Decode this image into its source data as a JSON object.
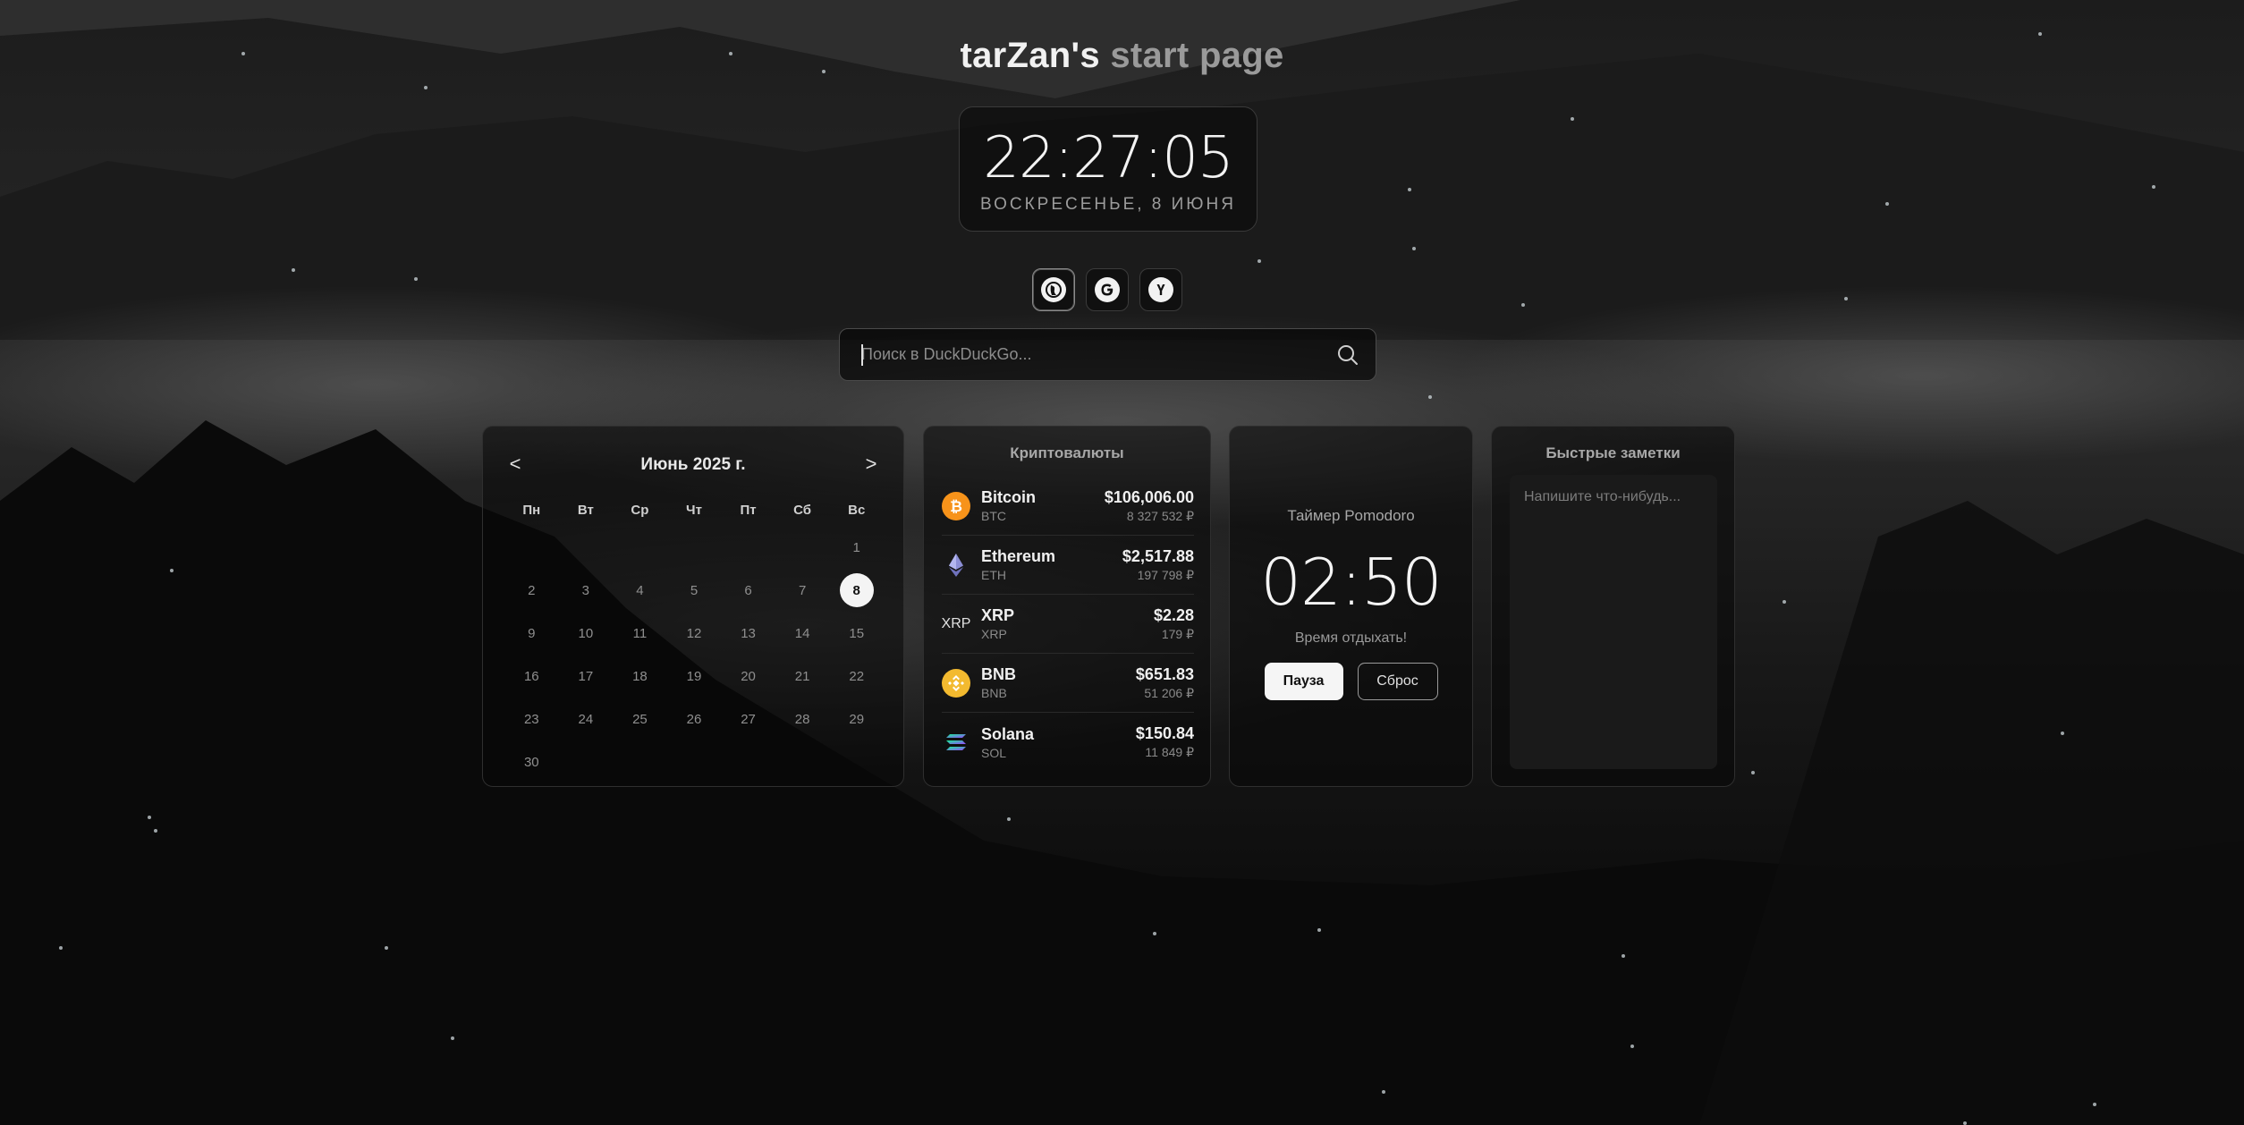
{
  "page_title": {
    "part1": "tarZan's",
    "part2": "start page"
  },
  "clock": {
    "time": "22:27:05",
    "date": "ВОСКРЕСЕНЬЕ, 8 ИЮНЯ"
  },
  "engines": [
    {
      "name": "DuckDuckGo",
      "glyph": "duckduckgo-icon",
      "active": true
    },
    {
      "name": "Google",
      "glyph": "google-icon",
      "active": false
    },
    {
      "name": "Yandex",
      "glyph": "yandex-icon",
      "active": false
    }
  ],
  "search": {
    "placeholder": "Поиск в DuckDuckGo...",
    "value": ""
  },
  "calendar": {
    "month_label": "Июнь 2025 г.",
    "prev_label": "<",
    "next_label": ">",
    "weekdays": [
      "Пн",
      "Вт",
      "Ср",
      "Чт",
      "Пт",
      "Сб",
      "Вс"
    ],
    "leading_blanks": 6,
    "days_in_month": 30,
    "today": 8
  },
  "crypto": {
    "title": "Криптовалюты",
    "coins": [
      {
        "name": "Bitcoin",
        "symbol": "BTC",
        "usd": "$106,006.00",
        "rub": "8 327 532 ₽",
        "color": "#f7931a"
      },
      {
        "name": "Ethereum",
        "symbol": "ETH",
        "usd": "$2,517.88",
        "rub": "197 798 ₽",
        "color": "#8c8fd6"
      },
      {
        "name": "XRP",
        "symbol": "XRP",
        "usd": "$2.28",
        "rub": "179 ₽",
        "icon_text": "XRP"
      },
      {
        "name": "BNB",
        "symbol": "BNB",
        "usd": "$651.83",
        "rub": "51 206 ₽",
        "color": "#f3ba2f"
      },
      {
        "name": "Solana",
        "symbol": "SOL",
        "usd": "$150.84",
        "rub": "11 849 ₽",
        "color": "#9945ff"
      }
    ]
  },
  "pomodoro": {
    "title": "Таймер Pomodoro",
    "time": "02:50",
    "status": "Время отдыхать!",
    "pause_label": "Пауза",
    "reset_label": "Сброс"
  },
  "notes": {
    "title": "Быстрые заметки",
    "placeholder": "Напишите что-нибудь...",
    "value": ""
  }
}
